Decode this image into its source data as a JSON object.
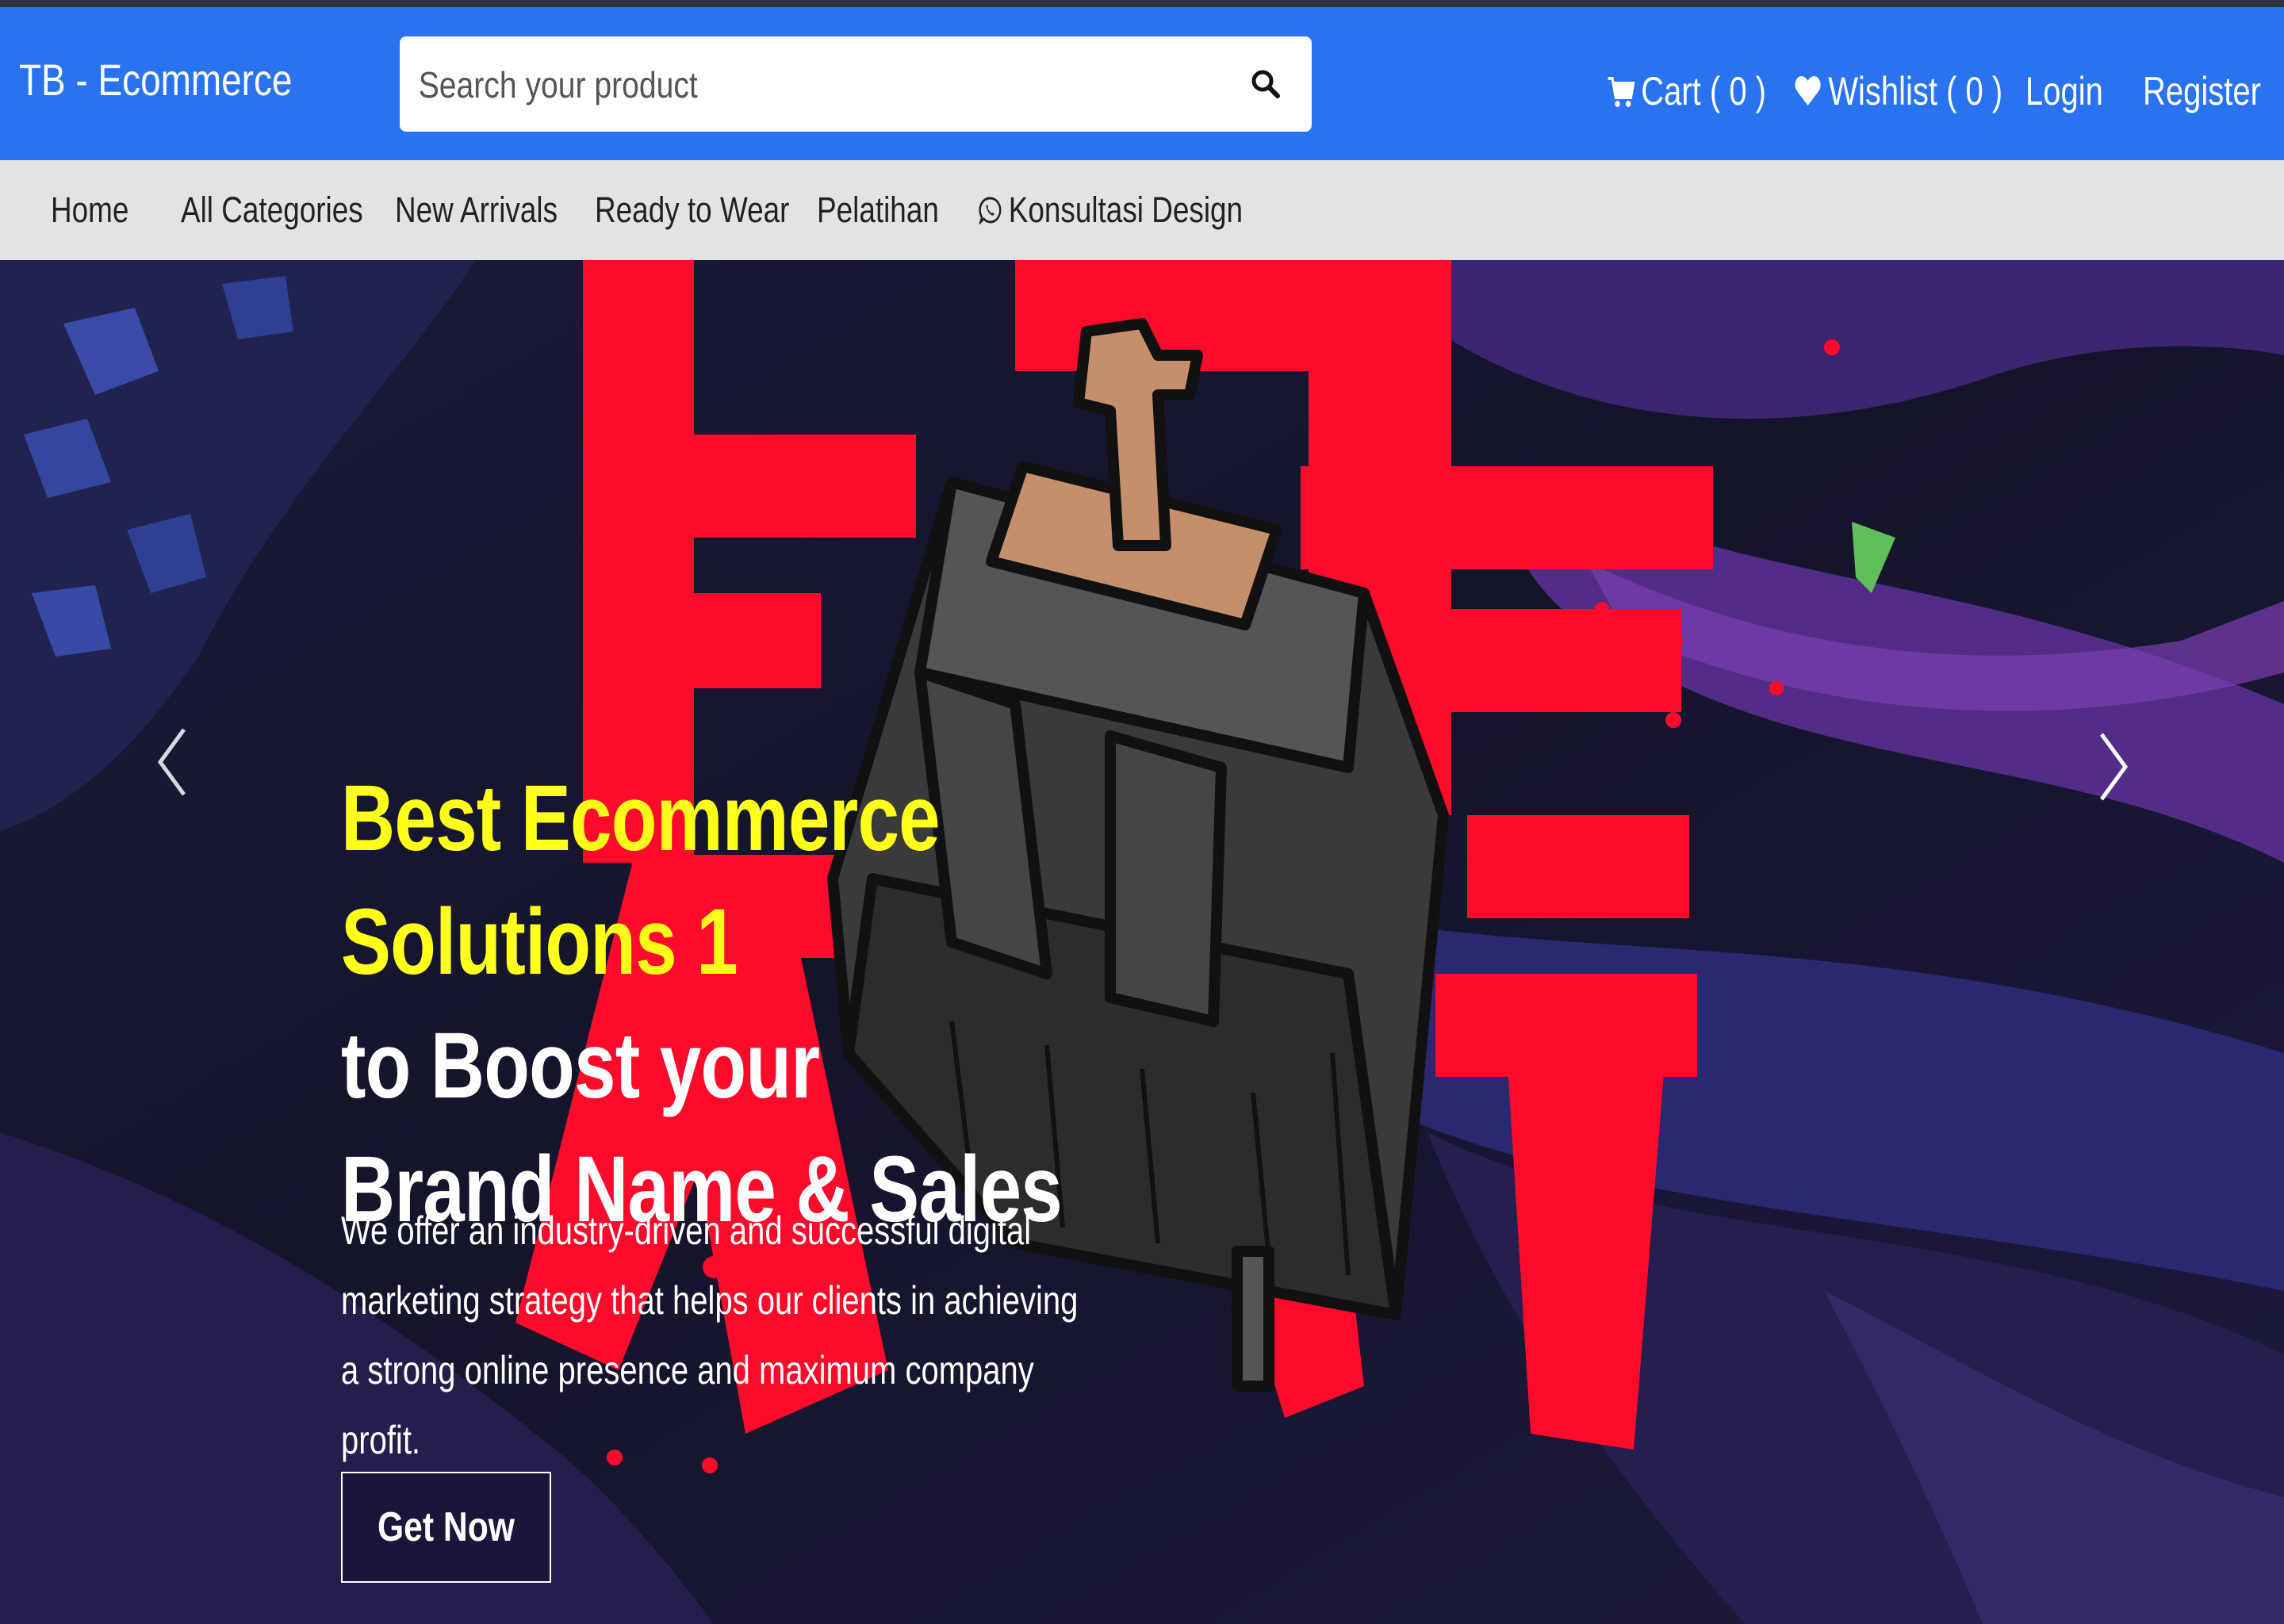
{
  "header": {
    "brand": "TB - Ecommerce",
    "search_placeholder": "Search your product",
    "cart_label": "Cart ( 0 )",
    "wishlist_label": "Wishlist ( 0 )",
    "login_label": "Login",
    "register_label": "Register"
  },
  "nav": {
    "items": [
      {
        "label": "Home"
      },
      {
        "label": "All Categories"
      },
      {
        "label": "New Arrivals"
      },
      {
        "label": "Ready to Wear"
      },
      {
        "label": "Pelatihan"
      },
      {
        "label": "Konsultasi Design",
        "icon": "whatsapp-icon"
      }
    ]
  },
  "hero": {
    "headline": {
      "part1": "Best Ecommerce",
      "part2": "Solutions",
      "part3": "1",
      "part4": "to Boost your",
      "part5": "Brand Name & Sales"
    },
    "description": "We offer an industry-driven and successful digital marketing strategy that helps our clients in achieving a strong online presence and maximum company profit.",
    "cta_label": "Get Now"
  },
  "colors": {
    "header_bg": "#2a73f0",
    "nav_bg": "#e3e3e3",
    "headline_highlight": "#ffff1a",
    "hero_red": "#ff0a2a"
  }
}
